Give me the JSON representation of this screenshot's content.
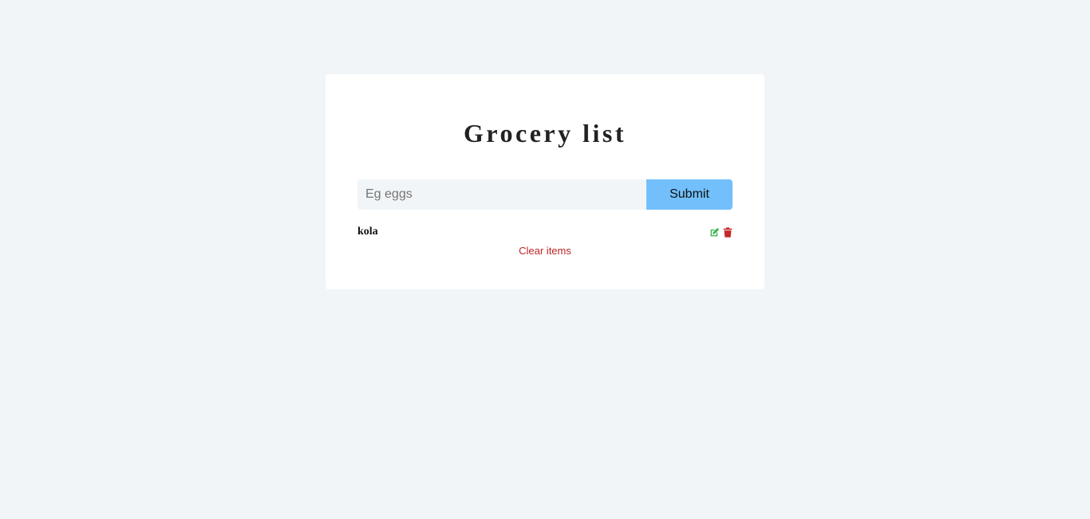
{
  "header": {
    "title": "Grocery list"
  },
  "form": {
    "placeholder": "Eg eggs",
    "value": "",
    "submit_label": "Submit"
  },
  "items": [
    {
      "name": "kola"
    }
  ],
  "clear_label": "Clear items",
  "icons": {
    "edit": "edit-icon",
    "delete": "trash-icon"
  },
  "colors": {
    "background": "#f1f5f8",
    "submit": "#72bffb",
    "edit": "#2fb344",
    "delete": "#c62828",
    "clear": "#bb2525"
  }
}
